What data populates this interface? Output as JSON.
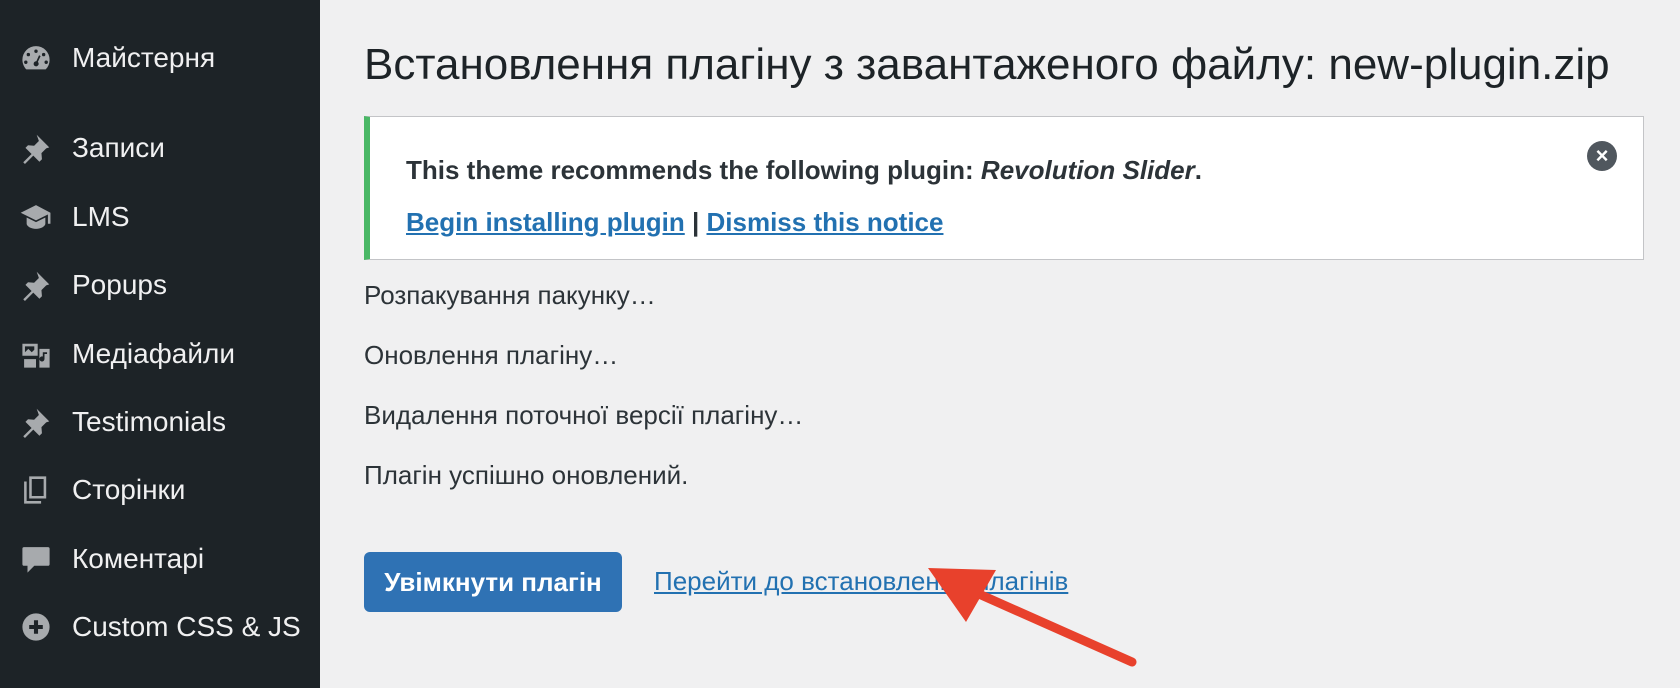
{
  "sidebar": {
    "items": [
      {
        "label": "Майстерня",
        "icon": "dashboard-icon"
      },
      {
        "label": "Записи",
        "icon": "pushpin-icon"
      },
      {
        "label": "LMS",
        "icon": "graduation-cap-icon"
      },
      {
        "label": "Popups",
        "icon": "pushpin-icon"
      },
      {
        "label": "Медіафайли",
        "icon": "media-icon"
      },
      {
        "label": "Testimonials",
        "icon": "pushpin-icon"
      },
      {
        "label": "Сторінки",
        "icon": "pages-icon"
      },
      {
        "label": "Коментарі",
        "icon": "comment-icon"
      },
      {
        "label": "Custom CSS & JS",
        "icon": "plus-circle-icon"
      }
    ]
  },
  "main": {
    "title": "Встановлення плагіну з завантаженого файлу: new-plugin.zip",
    "notice": {
      "text_prefix": "This theme recommends the following plugin: ",
      "plugin_name": "Revolution Slider",
      "text_suffix": ".",
      "begin_link": "Begin installing plugin",
      "separator": " | ",
      "dismiss_link": "Dismiss this notice",
      "close_glyph": "×"
    },
    "log": [
      "Розпакування пакунку…",
      "Оновлення плагіну…",
      "Видалення поточної версії плагіну…",
      "Плагін успішно оновлений."
    ],
    "activate_button": "Увімкнути плагін",
    "back_link": "Перейти до встановлення плагінів"
  },
  "colors": {
    "sidebar_bg": "#1d2327",
    "accent_link": "#2271b1",
    "button_bg": "#2f72b4",
    "notice_border": "#4ab866",
    "arrow": "#e8412c"
  }
}
